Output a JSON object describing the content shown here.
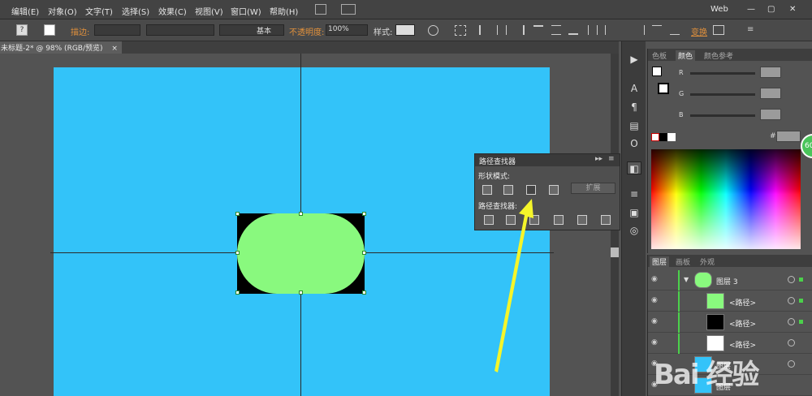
{
  "menubar": {
    "items": [
      "编辑(E)",
      "对象(O)",
      "文字(T)",
      "选择(S)",
      "效果(C)",
      "视图(V)",
      "窗口(W)",
      "帮助(H)"
    ],
    "workspace": "Web"
  },
  "toolbar": {
    "stroke_label": "描边:",
    "stroke_style": "基本",
    "opacity_label": "不透明度:",
    "opacity_value": "100%",
    "style_label": "样式:",
    "transform_label": "变换"
  },
  "document": {
    "tab_title": "未标题-2* @ 98% (RGB/预览)",
    "close": "×"
  },
  "color_panel": {
    "tabs": [
      "色板",
      "颜色",
      "颜色参考"
    ],
    "active_tab": "颜色",
    "channels": [
      "R",
      "G",
      "B"
    ],
    "hex_label": "#",
    "badge": "60"
  },
  "pathfinder": {
    "title": "路径查找器",
    "shape_modes_label": "形状模式:",
    "pathfinders_label": "路径查找器:",
    "expand_label": "扩展"
  },
  "layers_panel": {
    "tabs": [
      "图层",
      "画板",
      "外观"
    ],
    "rows": [
      {
        "name": "图层 3"
      },
      {
        "name": "<路径>"
      },
      {
        "name": "<路径>"
      },
      {
        "name": "<路径>"
      },
      {
        "name": "图层"
      },
      {
        "name": "图层"
      }
    ]
  },
  "watermark": {
    "text": "Bai 经验"
  },
  "colors": {
    "artboard": "#33c3f9",
    "shape_fill": "#89f97e",
    "arrow": "#f5f52a",
    "accent_orange": "#e2913c"
  }
}
